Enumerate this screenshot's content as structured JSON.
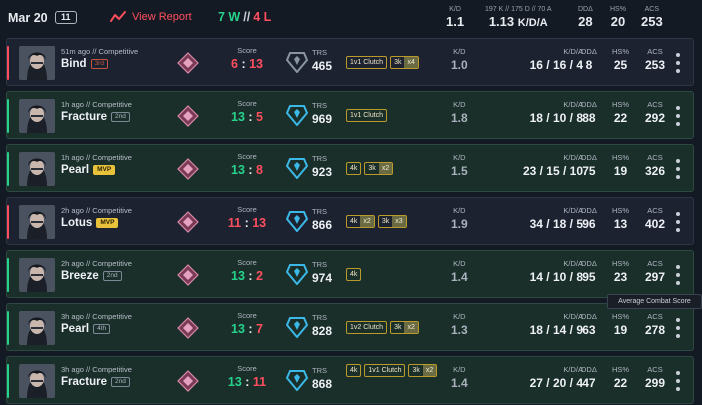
{
  "header": {
    "date": "Mar 20",
    "match_count": "11",
    "report_label": "View Report",
    "wins": "7 W",
    "separator": "//",
    "losses": "4 L",
    "kd_label": "K/D",
    "kd_value": "1.1",
    "kda_label": "197 K // 175 D // 70 A",
    "kda_value": "1.13",
    "kda_unit": "K/D/A",
    "dd_label": "DDΔ",
    "dd_value": "28",
    "hs_label": "HS%",
    "hs_value": "20",
    "acs_label": "ACS",
    "acs_value": "253"
  },
  "labels": {
    "score": "Score",
    "trs": "TRS",
    "kd": "K/D",
    "kda": "K/D/A",
    "dd": "DDΔ",
    "hs": "HS%",
    "acs": "ACS"
  },
  "matches": [
    {
      "result": "loss",
      "meta": "51m ago // Competitive",
      "map": "Bind",
      "placement": "3rd",
      "score_a": "6",
      "score_b": "13",
      "trs": "465",
      "tags": [
        {
          "t": "1v1 Clutch"
        },
        {
          "t": "3k",
          "x": "x4"
        }
      ],
      "kd": "1.0",
      "kda": "16 / 16 / 4",
      "dd": "8",
      "hs": "25",
      "acs": "253"
    },
    {
      "result": "win",
      "meta": "1h ago // Competitive",
      "map": "Fracture",
      "placement": "2nd",
      "score_a": "13",
      "score_b": "5",
      "trs": "969",
      "tags": [
        {
          "t": "1v1 Clutch"
        }
      ],
      "kd": "1.8",
      "kda": "18 / 10 / 8",
      "dd": "88",
      "hs": "22",
      "acs": "292"
    },
    {
      "result": "win",
      "meta": "1h ago // Competitive",
      "map": "Pearl",
      "placement": "MVP",
      "score_a": "13",
      "score_b": "8",
      "trs": "923",
      "tags": [
        {
          "t": "4k"
        },
        {
          "t": "3k",
          "x": "x2"
        }
      ],
      "kd": "1.5",
      "kda": "23 / 15 / 10",
      "dd": "75",
      "hs": "19",
      "acs": "326"
    },
    {
      "result": "loss",
      "meta": "2h ago // Competitive",
      "map": "Lotus",
      "placement": "MVP",
      "score_a": "11",
      "score_b": "13",
      "trs": "866",
      "tags": [
        {
          "t": "4k",
          "x": "x2"
        },
        {
          "t": "3k",
          "x": "x3"
        }
      ],
      "kd": "1.9",
      "kda": "34 / 18 / 5",
      "dd": "96",
      "hs": "13",
      "acs": "402"
    },
    {
      "result": "win",
      "meta": "2h ago // Competitive",
      "map": "Breeze",
      "placement": "2nd",
      "score_a": "13",
      "score_b": "2",
      "trs": "974",
      "tags": [
        {
          "t": "4k"
        }
      ],
      "kd": "1.4",
      "kda": "14 / 10 / 8",
      "dd": "95",
      "hs": "23",
      "acs": "297"
    },
    {
      "result": "win",
      "meta": "3h ago // Competitive",
      "map": "Pearl",
      "placement": "4th",
      "score_a": "13",
      "score_b": "7",
      "trs": "828",
      "tags": [
        {
          "t": "1v2 Clutch"
        },
        {
          "t": "3k",
          "x": "x2"
        }
      ],
      "kd": "1.3",
      "kda": "18 / 14 / 9",
      "dd": "63",
      "hs": "19",
      "acs": "278"
    },
    {
      "result": "win",
      "meta": "3h ago // Competitive",
      "map": "Fracture",
      "placement": "2nd",
      "score_a": "13",
      "score_b": "11",
      "trs": "868",
      "tags": [
        {
          "t": "4k"
        },
        {
          "t": "1v1 Clutch"
        },
        {
          "t": "3k",
          "x": "x2"
        }
      ],
      "kd": "1.4",
      "kda": "27 / 20 / 4",
      "dd": "47",
      "hs": "22",
      "acs": "299"
    }
  ],
  "tooltip": "Average Combat Score",
  "colors": {
    "win": "#27d38c",
    "loss": "#ff4f5e",
    "win_row_bg": "#1a2e2a",
    "loss_row_bg": "#1c2230",
    "mvp_badge": "#e8c23a",
    "trs_high": "#3bb8e6",
    "trs_low": "#8a94a3",
    "rank_icon": "#d88aa8"
  },
  "icons": {
    "report": "chart-line-icon",
    "rank": "rank-diamond-icon",
    "trs": "trs-shield-icon",
    "menu": "kebab-menu-icon"
  }
}
